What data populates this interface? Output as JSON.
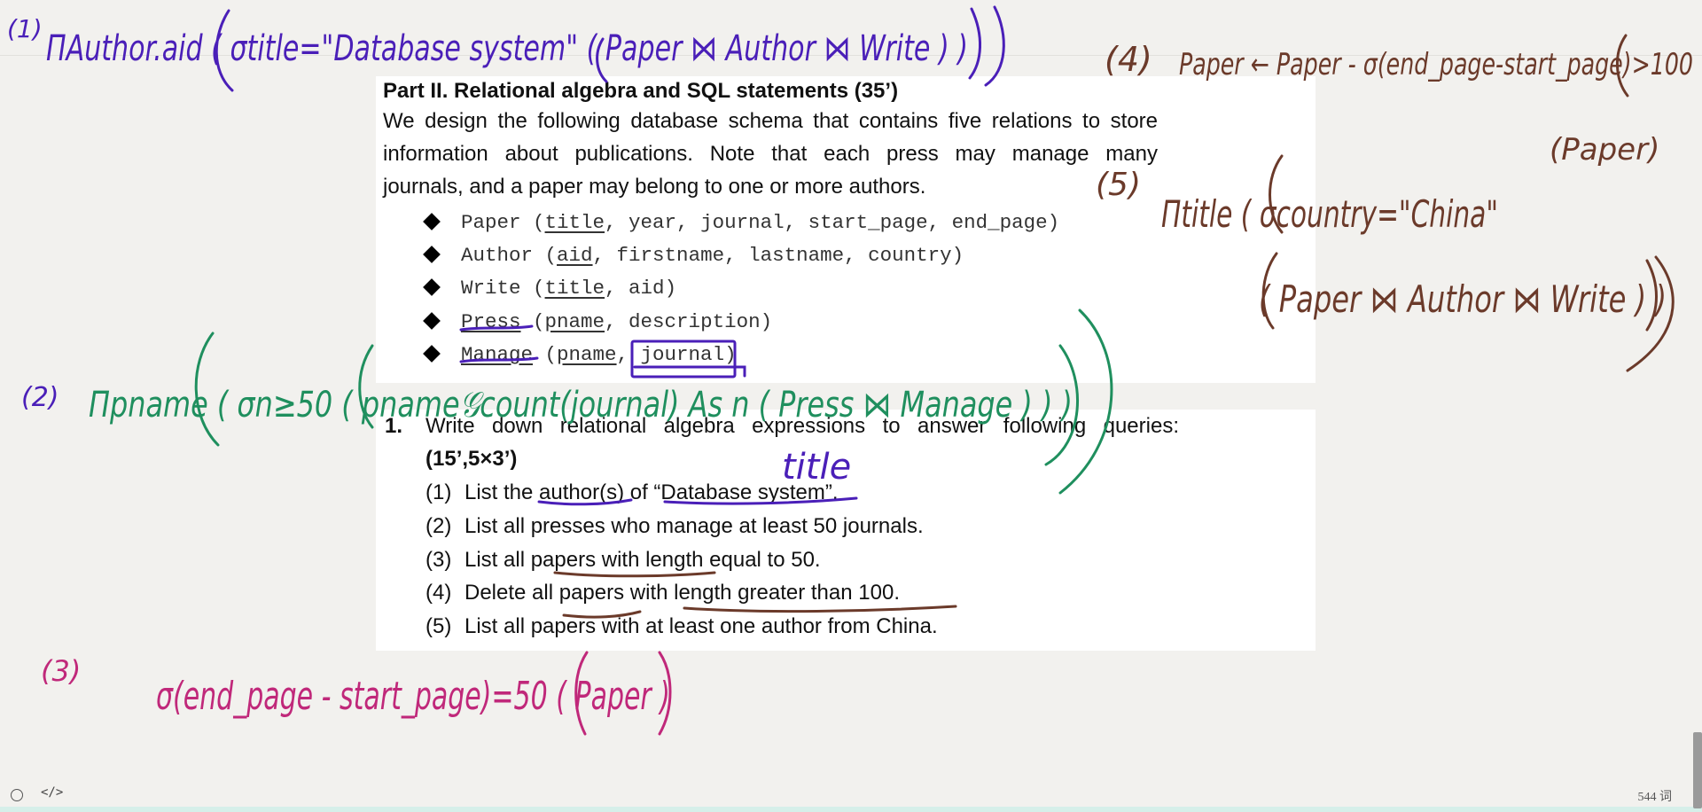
{
  "document": {
    "section_title": "Part II. Relational algebra and SQL statements    (35’)",
    "intro_lines": [
      "We design the following database schema that contains five relations to store",
      "information about publications. Note that each press may manage many",
      "journals, and a paper may belong to one or more authors."
    ],
    "schema": [
      {
        "rel": "Paper",
        "keys": "title",
        "rest": ", year, journal, start_page, end_page"
      },
      {
        "rel": "Author",
        "keys": "aid",
        "rest": ", firstname, lastname, country"
      },
      {
        "rel": "Write",
        "keys": "title",
        "rest": ", aid"
      },
      {
        "rel": "Press",
        "keys": "pname",
        "rest": ", description"
      },
      {
        "rel": "Manage",
        "keys": "pname",
        "rest": ", journal"
      }
    ],
    "question_number": "1.",
    "question_line1": "Write down relational algebra expressions to answer following queries:",
    "question_line2": "(15’,5×3’)",
    "queries": [
      {
        "num": "(1)",
        "text": "List the author(s) of “Database system”."
      },
      {
        "num": "(2)",
        "text": "List all presses who manage at least 50 journals."
      },
      {
        "num": "(3)",
        "text": "List all papers with length equal to 50."
      },
      {
        "num": "(4)",
        "text": "Delete all papers with length greater than 100."
      },
      {
        "num": "(5)",
        "text": "List all papers with at least one author from China."
      }
    ]
  },
  "annotations": {
    "a1_label": "(1)",
    "a1_expr": "ΠAuthor.aid ( σtitle=\"Database system\" ( Paper ⋈ Author ⋈ Write ) )",
    "a2_label": "(2)",
    "a2_expr": "Πpname ( σn≥50 ( pname𝒢count(journal) As n ( Press ⋈ Manage ) ) )",
    "a2_title_note": "title",
    "a3_label": "(3)",
    "a3_expr": "σ(end_page - start_page)=50 ( Paper )",
    "a4_label": "(4)",
    "a4_expr": "Paper ← Paper - σ(end_page-start_page)>100",
    "a4_expr2": "(Paper)",
    "a5_label": "(5)",
    "a5_expr": "Πtitle ( σcountry=\"China\"",
    "a5_expr2": "( Paper ⋈ Author ⋈ Write ) )",
    "colors": {
      "blue": "#4a1fb8",
      "green": "#1f8f5e",
      "magenta": "#c0287a",
      "brown": "#6b3a2a"
    }
  },
  "statusbar": {
    "code_icon": "</>",
    "word_count": "544 词"
  }
}
